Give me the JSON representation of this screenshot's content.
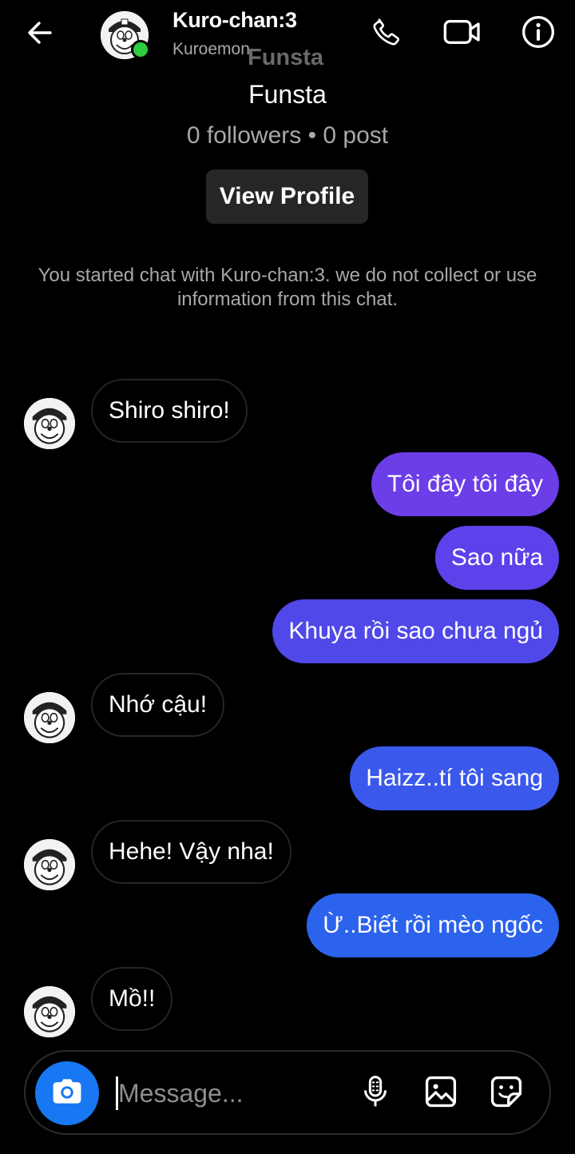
{
  "header": {
    "back_icon": "arrow-left-icon",
    "contact_name": "Kuro-chan:3",
    "contact_subtitle": "Kuroemon",
    "ghost_title": "Funsta",
    "online": true,
    "online_color": "#2ecc40",
    "actions": [
      "phone-icon",
      "video-camera-icon",
      "info-icon"
    ]
  },
  "profile": {
    "name": "Funsta",
    "stats": "0 followers • 0 post",
    "view_profile_label": "View Profile"
  },
  "notice": "You started chat with Kuro-chan:3. we do not collect or use information from this chat.",
  "messages": [
    {
      "direction": "incoming",
      "text": "Shiro shiro!",
      "show_avatar": true
    },
    {
      "direction": "outgoing",
      "text": "Tôi đây tôi đây",
      "color": "#6b3ee8"
    },
    {
      "direction": "outgoing",
      "text": "Sao nữa",
      "color": "#5e41ea"
    },
    {
      "direction": "outgoing",
      "text": "Khuya rồi sao chưa ngủ",
      "color": "#5148e9"
    },
    {
      "direction": "incoming",
      "text": "Nhớ cậu!",
      "show_avatar": true
    },
    {
      "direction": "outgoing",
      "text": "Haizz..tí tôi sang",
      "color": "#3a58ec"
    },
    {
      "direction": "incoming",
      "text": "Hehe! Vậy nha!",
      "show_avatar": true
    },
    {
      "direction": "outgoing",
      "text": "Ừ..Biết rồi mèo ngốc",
      "color": "#2c63ed"
    },
    {
      "direction": "incoming",
      "text": "Mồ!!",
      "show_avatar": true
    }
  ],
  "composer": {
    "placeholder": "Message...",
    "camera_icon": "camera-icon",
    "tools": [
      "microphone-icon",
      "image-icon",
      "sticker-icon"
    ],
    "accent": "#1877f2"
  }
}
